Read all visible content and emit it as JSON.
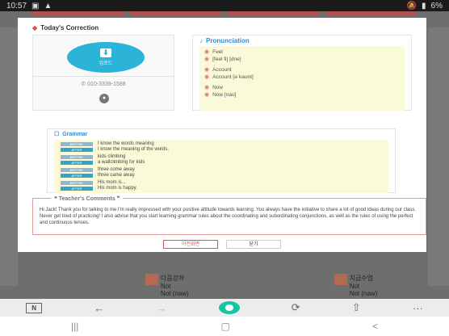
{
  "status_bar": {
    "time": "10:57",
    "battery": "6%"
  },
  "modal": {
    "todays_correction": "Today's Correction",
    "upload_label": "업로드",
    "phone_number": "010-3339-1588",
    "pronunciation_title": "Pronunciation",
    "pronunciation_items": [
      {
        "text": "Feel",
        "gap_before": false
      },
      {
        "text": "[feel fi] [dne]",
        "gap_before": false
      },
      {
        "text": "Account",
        "gap_before": true
      },
      {
        "text": "Account [əˈkaʊnt]",
        "gap_before": false
      },
      {
        "text": "Now",
        "gap_before": true
      },
      {
        "text": "Now [naʊ]",
        "gap_before": false
      }
    ],
    "grammar_title": "Grammar",
    "grammar_rows": [
      {
        "badge": "BEFORE",
        "type": "before",
        "text": "I know the words meaning",
        "gap": false
      },
      {
        "badge": "AFTER",
        "type": "after",
        "text": "I know the meaning of the words.",
        "gap": false
      },
      {
        "badge": "BEFORE",
        "type": "before",
        "text": "kids climbing",
        "gap": true
      },
      {
        "badge": "AFTER",
        "type": "after",
        "text": "a wallclimbing for kids",
        "gap": false
      },
      {
        "badge": "BEFORE",
        "type": "before",
        "text": "three come away",
        "gap": true
      },
      {
        "badge": "AFTER",
        "type": "after",
        "text": "three came away",
        "gap": false
      },
      {
        "badge": "BEFORE",
        "type": "before",
        "text": "His mom is...",
        "gap": true
      },
      {
        "badge": "AFTER",
        "type": "after",
        "text": "His mom is happy.",
        "gap": false
      }
    ],
    "teacher_title": "Teacher's Comments",
    "teacher_text": "Hi Jack! Thank you for talking to me I'm really impressed with your positive attitude towards learning. You always have the initiative to share a lot of good ideas during our class. Never get tired of practicing! I also advise that you start learning grammar rules about the coordinating and subordinating conjunctions, as well as the rules of using the perfect and continuous tenses.",
    "btn_primary": "이전화면",
    "btn_secondary": "닫기"
  },
  "background": {
    "items": [
      {
        "title": "다음강좌",
        "sub": "Not",
        "sub2": "Not (naw)"
      },
      {
        "title": "지금수업",
        "sub": "Not",
        "sub2": "Not (naw)"
      }
    ]
  },
  "browser_bar": {
    "tab_count": "N",
    "back": "←",
    "forward": "→",
    "refresh": "⟳",
    "share": "⇧",
    "more": "···"
  },
  "nav_bar": {
    "recent": "|||",
    "home": "▢",
    "back": "<"
  },
  "colors": {
    "accent_red": "#e05050",
    "accent_blue": "#2bb4d7",
    "accent_green": "#17c7a2",
    "highlight_yellow": "#fafad8"
  }
}
